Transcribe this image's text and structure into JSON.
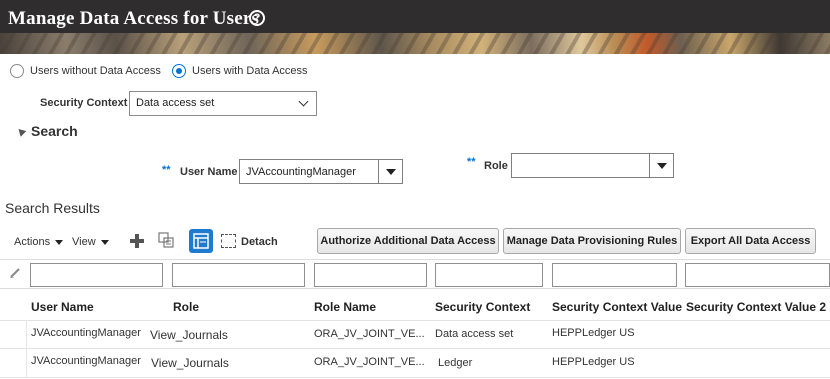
{
  "header": {
    "title": "Manage Data Access for Users",
    "help_glyph": "?"
  },
  "mode": {
    "options": [
      "Users without Data Access",
      "Users with Data Access"
    ],
    "selected": "Users with Data Access"
  },
  "security_context": {
    "label": "Security Context",
    "value": "Data access set"
  },
  "search": {
    "title": "Search",
    "required_marker": "**",
    "user_name": {
      "label": "User Name",
      "value": "JVAccountingManager"
    },
    "role": {
      "label": "Role",
      "value": ""
    }
  },
  "results": {
    "title": "Search Results",
    "toolbar": {
      "actions_label": "Actions",
      "view_label": "View",
      "detach_label": "Detach",
      "buttons": [
        "Authorize Additional Data Access",
        "Manage Data Provisioning Rules",
        "Export All Data Access"
      ]
    },
    "columns": [
      "User Name",
      "Role",
      "Role Name",
      "Security Context",
      "Security Context Value",
      "Security Context Value 2"
    ],
    "rows": [
      [
        "JVAccountingManager",
        "View_Journals",
        "ORA_JV_JOINT_VE...",
        "Data access set",
        "HEPPLedger US",
        ""
      ],
      [
        "JVAccountingManager",
        "View_Journals",
        "ORA_JV_JOINT_VE...",
        "Ledger",
        "HEPPLedger US",
        ""
      ]
    ]
  },
  "icons": [
    "help-icon",
    "chevron-down-icon",
    "collapse-triangle-icon",
    "dropdown-caret-icon",
    "add-icon",
    "format-icon",
    "freeze-icon",
    "detach-icon",
    "clear-filter-pencil-icon"
  ],
  "colors": {
    "accent": "#0572ce",
    "header_bg": "#2f2d2d",
    "freeze_button": "#1f7bd0"
  }
}
